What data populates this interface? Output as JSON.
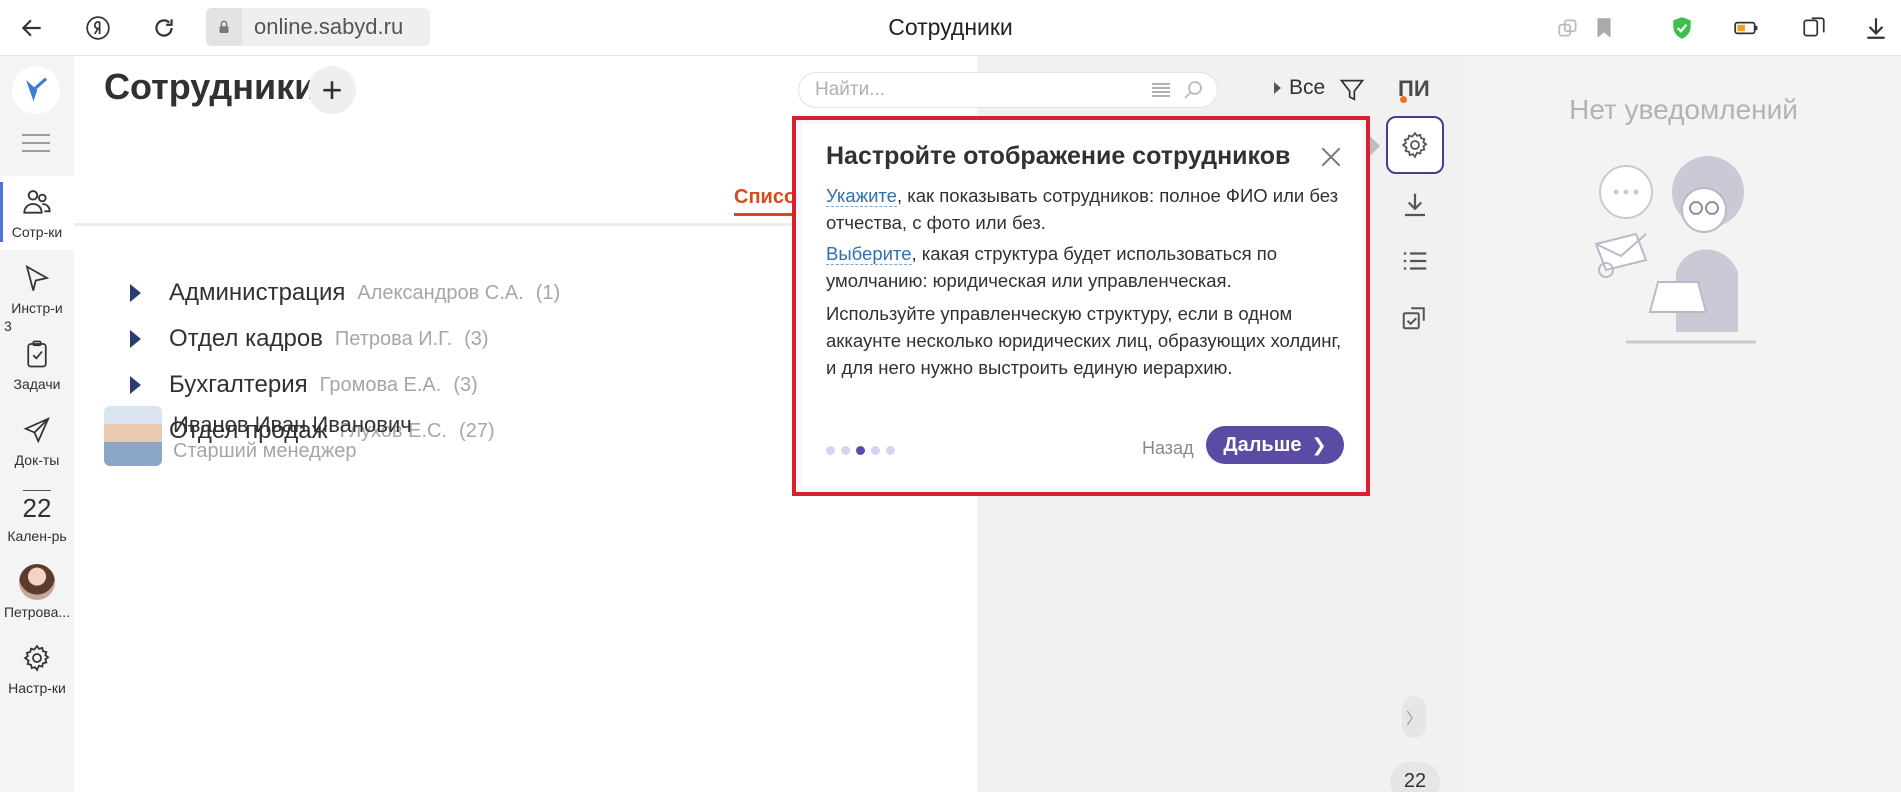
{
  "browser": {
    "url": "online.sabyd.ru",
    "title": "Сотрудники"
  },
  "nav": {
    "items": [
      {
        "label": "Сотр-ки"
      },
      {
        "label": "Инстр-и"
      },
      {
        "label": "Задачи"
      },
      {
        "label": "Док-ты"
      },
      {
        "label": "Кален-рь"
      },
      {
        "label": "Петрова..."
      },
      {
        "label": "Настр-ки"
      }
    ],
    "tasks_count": "3",
    "calendar_day": "22"
  },
  "header": {
    "page_title": "Сотрудники",
    "search_placeholder": "Найти...",
    "filter_all": "Все",
    "user_initials": "ПИ"
  },
  "tabs": {
    "active": "Список"
  },
  "departments": [
    {
      "name": "Администрация",
      "head": "Александров С.А.",
      "count": "(1)"
    },
    {
      "name": "Отдел кадров",
      "head": "Петрова И.Г.",
      "count": "(3)"
    },
    {
      "name": "Бухгалтерия",
      "head": "Громова Е.А.",
      "count": "(3)"
    },
    {
      "name": "Отдел продаж",
      "head": "Глухов Е.С.",
      "count": "(27)"
    }
  ],
  "employee": {
    "name": "Иванов Иван Иванович",
    "position": "Старший менеджер"
  },
  "notifications": {
    "empty_text": "Нет уведомлений",
    "badge": "22"
  },
  "popup": {
    "title": "Настройте отображение сотрудников",
    "p1_link": "Укажите",
    "p1_rest": ", как показывать сотрудников: полное ФИО или без отчества, с фото или без.",
    "p2_link": "Выберите",
    "p2_rest": ", какая структура будет использоваться по умолчанию: юридическая или управленческая.",
    "p3": "Используйте управленческую структуру, если в одном аккаунте несколько юридических лиц, образующих холдинг, и для него нужно выстроить единую иерархию.",
    "back_label": "Назад",
    "next_label": "Дальше",
    "steps_total": 5,
    "current_step": 3
  },
  "colors": {
    "accent": "#5b4ba5",
    "highlight_border": "#d8202f",
    "tab_active": "#d64b1b",
    "link": "#2d6fb3"
  }
}
